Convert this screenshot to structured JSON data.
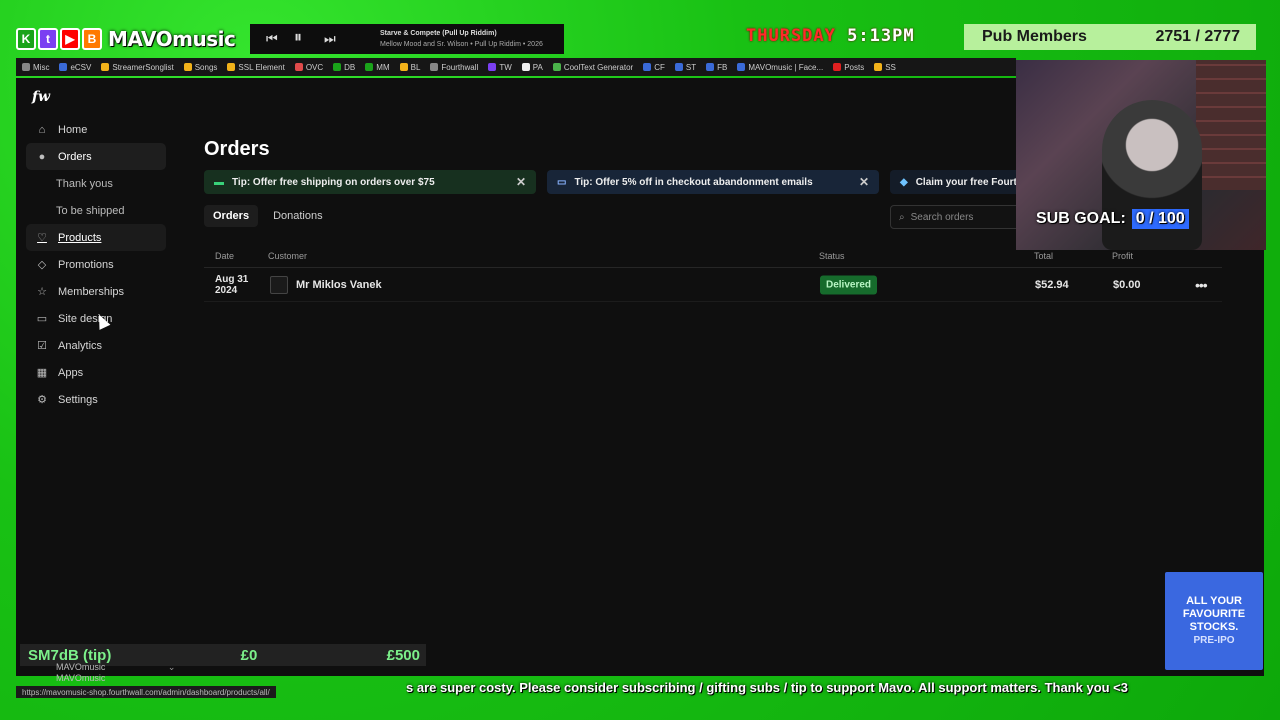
{
  "overlay": {
    "logo_text": "MAVOmusic",
    "logo_tiles": [
      {
        "icon": "kick-icon",
        "letter": "K",
        "color": "#1aa31a"
      },
      {
        "icon": "twitch-icon",
        "letter": "t",
        "color": "#7b3ff2"
      },
      {
        "icon": "youtube-icon",
        "letter": "▶",
        "color": "#ff0000"
      },
      {
        "icon": "b-icon",
        "letter": "B",
        "color": "#ff7a00"
      }
    ],
    "now_playing": {
      "title": "Starve & Compete (Pull Up Riddim)",
      "artist": "Mellow Mood and Sr. Wilson • Pull Up Riddim • 2026"
    },
    "clock_day": "THURSDAY",
    "clock_time": "5:13PM",
    "pub_members_label": "Pub Members",
    "pub_members_count": "2751 / 2777",
    "sub_goal_label": "SUB GOAL:",
    "sub_goal_value": "0 / 100",
    "tip_label": "SM7dB (tip)",
    "tip_current": "£0",
    "tip_goal": "£500",
    "ticker": "s are super costy. Please consider subscribing / gifting subs / tip to support Mavo. All support matters. Thank you <3",
    "ad_lines": [
      "ALL YOUR",
      "FAVOURITE",
      "STOCKS."
    ],
    "ad_sub": "PRE-IPO"
  },
  "bookmarks": [
    {
      "label": "Misc",
      "color": "#888"
    },
    {
      "label": "eCSV",
      "color": "#3a6ad8"
    },
    {
      "label": "StreamerSonglist",
      "color": "#f2b21a"
    },
    {
      "label": "Songs",
      "color": "#f2b21a"
    },
    {
      "label": "SSL Element",
      "color": "#f2b21a"
    },
    {
      "label": "OVC",
      "color": "#e04b4b"
    },
    {
      "label": "DB",
      "color": "#1aa31a"
    },
    {
      "label": "MM",
      "color": "#1aa31a"
    },
    {
      "label": "BL",
      "color": "#f2b21a"
    },
    {
      "label": "Fourthwall",
      "color": "#888"
    },
    {
      "label": "TW",
      "color": "#7b3ff2"
    },
    {
      "label": "PA",
      "color": "#eee"
    },
    {
      "label": "CoolText Generator",
      "color": "#4ab34a"
    },
    {
      "label": "CF",
      "color": "#3a6ad8"
    },
    {
      "label": "ST",
      "color": "#3a6ad8"
    },
    {
      "label": "FB",
      "color": "#3a6ad8"
    },
    {
      "label": "MAVOmusic | Face...",
      "color": "#3a6ad8"
    },
    {
      "label": "Posts",
      "color": "#e02020"
    },
    {
      "label": "SS",
      "color": "#f2b21a"
    }
  ],
  "app": {
    "brand": "fw",
    "nav": [
      {
        "label": "Home",
        "icon": "home-icon",
        "glyph": "⌂",
        "sub": false,
        "state": ""
      },
      {
        "label": "Orders",
        "icon": "orders-icon",
        "glyph": "●",
        "sub": false,
        "state": "active"
      },
      {
        "label": "Thank yous",
        "icon": "",
        "glyph": "",
        "sub": true,
        "state": ""
      },
      {
        "label": "To be shipped",
        "icon": "",
        "glyph": "",
        "sub": true,
        "state": ""
      },
      {
        "label": "Products",
        "icon": "products-icon",
        "glyph": "♡",
        "sub": false,
        "state": "hover"
      },
      {
        "label": "Promotions",
        "icon": "tag-icon",
        "glyph": "◇",
        "sub": false,
        "state": ""
      },
      {
        "label": "Memberships",
        "icon": "star-icon",
        "glyph": "☆",
        "sub": false,
        "state": ""
      },
      {
        "label": "Site design",
        "icon": "layout-icon",
        "glyph": "▭",
        "sub": false,
        "state": ""
      },
      {
        "label": "Analytics",
        "icon": "analytics-icon",
        "glyph": "☑",
        "sub": false,
        "state": ""
      },
      {
        "label": "Apps",
        "icon": "apps-icon",
        "glyph": "▦",
        "sub": false,
        "state": ""
      },
      {
        "label": "Settings",
        "icon": "gear-icon",
        "glyph": "⚙",
        "sub": false,
        "state": ""
      }
    ],
    "page_title": "Orders",
    "tips": [
      "Tip: Offer free shipping on orders over $75",
      "Tip: Offer 5% off in checkout abandonment emails",
      "Claim your free Fourthwall"
    ],
    "tabs": [
      "Orders",
      "Donations"
    ],
    "search_placeholder": "Search orders",
    "columns": {
      "date": "Date",
      "customer": "Customer",
      "status": "Status",
      "total": "Total",
      "profit": "Profit"
    },
    "rows": [
      {
        "date_line1": "Aug 31",
        "date_line2": "2024",
        "customer": "Mr Miklos Vanek",
        "status": "Delivered",
        "total": "$52.94",
        "profit": "$0.00"
      }
    ],
    "account_name": "MAVOmusic",
    "account_sub": "MAVOmusic",
    "status_url": "https://mavomusic-shop.fourthwall.com/admin/dashboard/products/all/"
  }
}
